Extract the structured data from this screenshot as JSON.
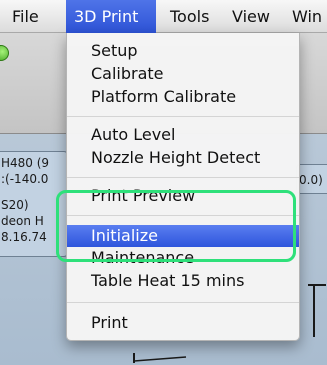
{
  "menubar": {
    "items": [
      {
        "label": "File",
        "active": false
      },
      {
        "label": "3D Print",
        "active": true
      },
      {
        "label": "Tools",
        "active": false
      },
      {
        "label": "View",
        "active": false
      },
      {
        "label": "Win",
        "active": false
      }
    ]
  },
  "background": {
    "info_lines": [
      "H480 (9",
      ":(-140.0",
      "S20)",
      "deon H",
      "8.16.74"
    ],
    "right_tag": "0.0)"
  },
  "dropdown": {
    "items": [
      {
        "label": "Setup",
        "highlighted": false
      },
      {
        "label": "Calibrate",
        "highlighted": false
      },
      {
        "label": "Platform Calibrate",
        "highlighted": false
      },
      {
        "label": "Auto Level",
        "highlighted": false
      },
      {
        "label": "Nozzle Height Detect",
        "highlighted": false
      },
      {
        "label": "Print Preview",
        "highlighted": false
      },
      {
        "label": "Initialize",
        "highlighted": true
      },
      {
        "label": "Maintenance",
        "highlighted": false
      },
      {
        "label": "Table Heat 15 mins",
        "highlighted": false
      },
      {
        "label": "Print",
        "highlighted": false
      }
    ]
  },
  "colors": {
    "highlight": "#3a62e2",
    "annotation": "#2ee07a"
  }
}
